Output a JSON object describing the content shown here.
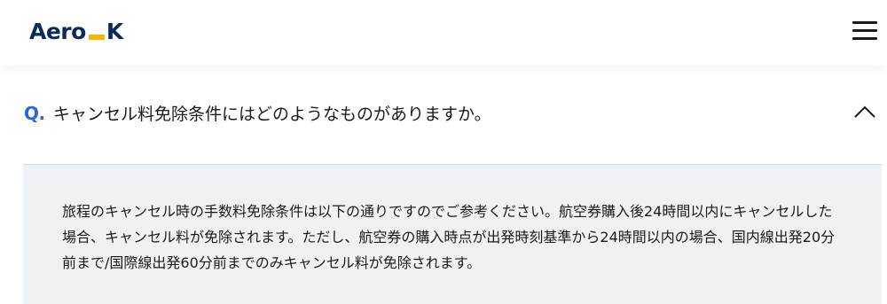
{
  "header": {
    "logo": {
      "text_left": "Aero",
      "text_right": "K",
      "accent_color": "#f5b800",
      "text_color": "#0d2a5c"
    },
    "menu_icon": "hamburger-menu-icon"
  },
  "faq": {
    "question_marker": "Q.",
    "question": "キャンセル料免除条件にはどのようなものがありますか。",
    "expanded_icon": "chevron-up-icon",
    "answer": "旅程のキャンセル時の手数料免除条件は以下の通りですのでご参考ください。航空券購入後24時間以内にキャンセルした場合、キャンセル料が免除されます。ただし、航空券の購入時点が出発時刻基準から24時間以内の場合、国内線出発20分前まで/国際線出発60分前までのみキャンセル料が免除されます。",
    "accent_color": "#2a68d8",
    "answer_background": "#eef2f5"
  }
}
